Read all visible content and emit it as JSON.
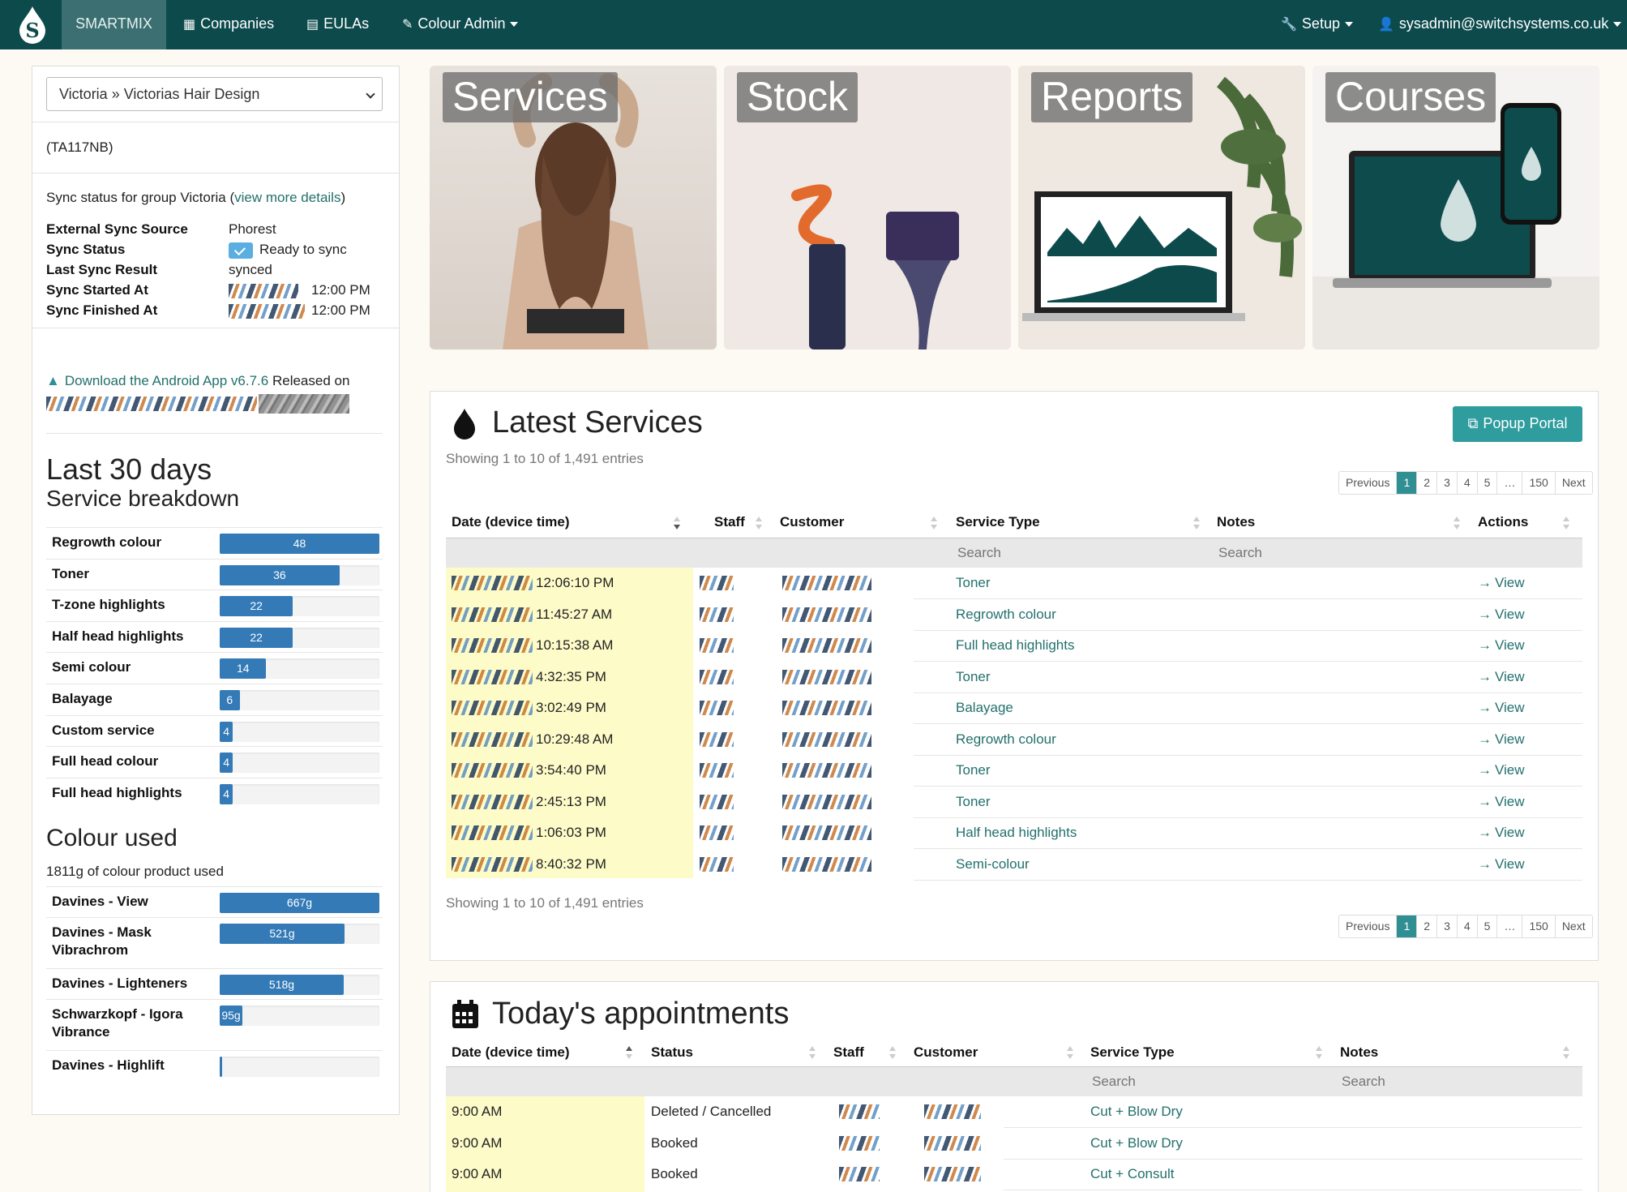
{
  "nav": {
    "brand": "SMARTMIX",
    "companies": "Companies",
    "eulas": "EULAs",
    "colour_admin": "Colour Admin",
    "setup": "Setup",
    "user": "sysadmin@switchsystems.co.uk"
  },
  "left": {
    "company_select": "Victoria » Victorias Hair Design",
    "code": "(TA117NB)",
    "sync_heading_prefix": "Sync status for group Victoria (",
    "sync_heading_link": "view more details",
    "sync_heading_suffix": ")",
    "sync": [
      {
        "label": "External Sync Source",
        "value": "Phorest"
      },
      {
        "label": "Sync Status",
        "value": "Ready to sync"
      },
      {
        "label": "Last Sync Result",
        "value": "synced"
      },
      {
        "label": "Sync Started At",
        "value": "12:00 PM"
      },
      {
        "label": "Sync Finished At",
        "value": "12:00 PM"
      }
    ],
    "android_link": "Download the Android App v6.7.6",
    "android_suffix": " Released on",
    "last30_title": "Last 30 days",
    "breakdown_title": "Service breakdown",
    "services": [
      {
        "name": "Regrowth colour",
        "value": 48,
        "label": "48"
      },
      {
        "name": "Toner",
        "value": 36,
        "label": "36"
      },
      {
        "name": "T-zone highlights",
        "value": 22,
        "label": "22"
      },
      {
        "name": "Half head highlights",
        "value": 22,
        "label": "22"
      },
      {
        "name": "Semi colour",
        "value": 14,
        "label": "14"
      },
      {
        "name": "Balayage",
        "value": 6,
        "label": "6"
      },
      {
        "name": "Custom service",
        "value": 4,
        "label": "4"
      },
      {
        "name": "Full head colour",
        "value": 4,
        "label": "4"
      },
      {
        "name": "Full head highlights",
        "value": 4,
        "label": "4"
      }
    ],
    "colour_title": "Colour used",
    "colour_total": "1811g of colour product used",
    "colours": [
      {
        "name": "Davines - View",
        "value": 667,
        "label": "667g"
      },
      {
        "name": "Davines - Mask Vibrachrom",
        "value": 521,
        "label": "521g"
      },
      {
        "name": "Davines - Lighteners",
        "value": 518,
        "label": "518g"
      },
      {
        "name": "Schwarzkopf - Igora Vibrance",
        "value": 95,
        "label": "95g"
      },
      {
        "name": "Davines - Highlift",
        "value": 10,
        "label": ""
      }
    ]
  },
  "tiles": [
    {
      "label": "Services"
    },
    {
      "label": "Stock"
    },
    {
      "label": "Reports"
    },
    {
      "label": "Courses"
    }
  ],
  "latest": {
    "title": "Latest Services",
    "popup_button": "Popup Portal",
    "showing": "Showing 1 to 10 of 1,491 entries",
    "pager": [
      "Previous",
      "1",
      "2",
      "3",
      "4",
      "5",
      "…",
      "150",
      "Next"
    ],
    "columns": [
      "Date (device time)",
      "Staff",
      "Customer",
      "Service Type",
      "Notes",
      "Actions"
    ],
    "search_placeholder": "Search",
    "rows": [
      {
        "time": "12:06:10 PM",
        "service": "Toner",
        "action": "View"
      },
      {
        "time": "11:45:27 AM",
        "service": "Regrowth colour",
        "action": "View"
      },
      {
        "time": "10:15:38 AM",
        "service": "Full head highlights",
        "action": "View"
      },
      {
        "time": "4:32:35 PM",
        "service": "Toner",
        "action": "View"
      },
      {
        "time": "3:02:49 PM",
        "service": "Balayage",
        "action": "View"
      },
      {
        "time": "10:29:48 AM",
        "service": "Regrowth colour",
        "action": "View"
      },
      {
        "time": "3:54:40 PM",
        "service": "Toner",
        "action": "View"
      },
      {
        "time": "2:45:13 PM",
        "service": "Toner",
        "action": "View"
      },
      {
        "time": "1:06:03 PM",
        "service": "Half head highlights",
        "action": "View"
      },
      {
        "time": "8:40:32 PM",
        "service": "Semi-colour",
        "action": "View"
      }
    ]
  },
  "appointments": {
    "title": "Today's appointments",
    "columns": [
      "Date (device time)",
      "Status",
      "Staff",
      "Customer",
      "Service Type",
      "Notes"
    ],
    "search_placeholder": "Search",
    "rows": [
      {
        "time": "9:00 AM",
        "status": "Deleted / Cancelled",
        "service": "Cut + Blow Dry"
      },
      {
        "time": "9:00 AM",
        "status": "Booked",
        "service": "Cut + Blow Dry"
      },
      {
        "time": "9:00 AM",
        "status": "Booked",
        "service": "Cut + Consult"
      }
    ]
  },
  "colors": {
    "navbar": "#0d4a4c",
    "accent": "#2f9c9e",
    "bar": "#337ab7",
    "link": "#22706d"
  }
}
